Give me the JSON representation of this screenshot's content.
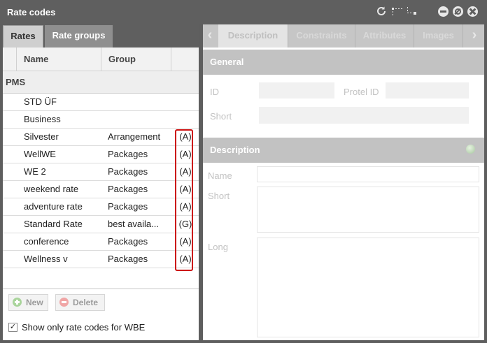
{
  "window": {
    "title": "Rate codes",
    "toolbar_icons": [
      "refresh-icon",
      "tree-collapse-icon",
      "tree-expand-icon",
      "minimize-icon",
      "cancel-icon",
      "close-icon"
    ]
  },
  "left_tabs": [
    {
      "label": "Rates",
      "active": true
    },
    {
      "label": "Rate groups",
      "active": false
    }
  ],
  "grid": {
    "columns": [
      "Name",
      "Group"
    ],
    "group_label": "PMS",
    "rows": [
      {
        "name": "STD ÜF",
        "group": "",
        "flag": ""
      },
      {
        "name": "Business",
        "group": "",
        "flag": ""
      },
      {
        "name": "Silvester",
        "group": "Arrangement",
        "flag": "(A)"
      },
      {
        "name": "WellWE",
        "group": "Packages",
        "flag": "(A)"
      },
      {
        "name": "WE 2",
        "group": "Packages",
        "flag": "(A)"
      },
      {
        "name": "weekend rate",
        "group": "Packages",
        "flag": "(A)"
      },
      {
        "name": "adventure rate",
        "group": "Packages",
        "flag": "(A)"
      },
      {
        "name": "Standard Rate",
        "group": "best availa...",
        "flag": "(G)"
      },
      {
        "name": "conference",
        "group": "Packages",
        "flag": "(A)"
      },
      {
        "name": "Wellness v",
        "group": "Packages",
        "flag": "(A)"
      }
    ]
  },
  "actions": {
    "new_label": "New",
    "delete_label": "Delete",
    "wbe_checkbox_label": "Show only rate codes for WBE",
    "wbe_checked": true
  },
  "right_tabs": [
    {
      "label": "Description",
      "active": true
    },
    {
      "label": "Constraints",
      "active": false
    },
    {
      "label": "Attributes",
      "active": false
    },
    {
      "label": "Images",
      "active": false
    }
  ],
  "general": {
    "title": "General",
    "id_label": "ID",
    "protel_id_label": "Protel ID",
    "short_label": "Short",
    "id_value": "",
    "protel_id_value": "",
    "short_value": ""
  },
  "description": {
    "title": "Description",
    "name_label": "Name",
    "short_label": "Short",
    "long_label": "Long",
    "name_value": "",
    "short_value": "",
    "long_value": ""
  },
  "colors": {
    "highlight_border": "#cc1010",
    "titlebar": "#5f5f5f",
    "section_header": "#c2c2c2"
  }
}
